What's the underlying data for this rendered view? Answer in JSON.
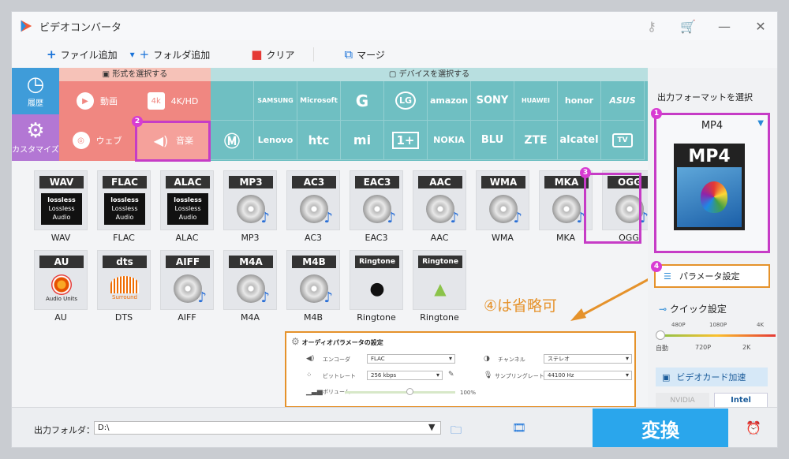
{
  "app": {
    "title": "ビデオコンバータ"
  },
  "toolbar": {
    "add_file": "ファイル追加",
    "add_folder": "フォルダ追加",
    "clear": "クリア",
    "merge": "マージ"
  },
  "sidebar": {
    "history": "履歴",
    "customize": "カスタマイズ"
  },
  "format_section": {
    "header": "形式を選択する",
    "items": [
      "動画",
      "4K/HD",
      "ウェブ",
      "音楽"
    ]
  },
  "device_section": {
    "header": "デバイスを選択する",
    "row1": [
      "",
      "SAMSUNG",
      "Microsoft",
      "G",
      "LG",
      "amazon",
      "SONY",
      "HUAWEI",
      "honor",
      "ASUS"
    ],
    "row2": [
      "",
      "Lenovo",
      "htc",
      "mi",
      "1+",
      "NOKIA",
      "BLU",
      "ZTE",
      "alcatel",
      "TV"
    ]
  },
  "formats": [
    {
      "name": "WAV",
      "top": "WAV",
      "type": "lossless"
    },
    {
      "name": "FLAC",
      "top": "FLAC",
      "type": "lossless"
    },
    {
      "name": "ALAC",
      "top": "ALAC",
      "type": "lossless"
    },
    {
      "name": "MP3",
      "top": "MP3",
      "type": "disc"
    },
    {
      "name": "AC3",
      "top": "AC3",
      "type": "disc"
    },
    {
      "name": "EAC3",
      "top": "EAC3",
      "type": "disc"
    },
    {
      "name": "AAC",
      "top": "AAC",
      "type": "disc"
    },
    {
      "name": "WMA",
      "top": "WMA",
      "type": "disc"
    },
    {
      "name": "MKA",
      "top": "MKA",
      "type": "disc"
    },
    {
      "name": "OGG",
      "top": "OGG",
      "type": "disc"
    },
    {
      "name": "AU",
      "top": "AU",
      "type": "au"
    },
    {
      "name": "DTS",
      "top": "dts",
      "type": "dts"
    },
    {
      "name": "AIFF",
      "top": "AIFF",
      "type": "disc"
    },
    {
      "name": "M4A",
      "top": "M4A",
      "type": "disc"
    },
    {
      "name": "M4B",
      "top": "M4B",
      "type": "disc"
    },
    {
      "name": "Ringtone",
      "top": "Ringtone",
      "type": "apple"
    },
    {
      "name": "Ringtone",
      "top": "Ringtone",
      "type": "android"
    }
  ],
  "lossless_text": {
    "brand": "lossless",
    "line1": "Lossless",
    "line2": "Audio"
  },
  "au_sub": "Audio Units",
  "dts_sub": "Surround",
  "annotation": "④は省略可",
  "audio_panel": {
    "title": "オーディオパラメータの設定",
    "encoder_label": "エンコーダ",
    "encoder": "FLAC",
    "bitrate_label": "ビットレート",
    "bitrate": "256 kbps",
    "volume_label": "ボリューム",
    "volume": "100%",
    "volume_level": 0.5,
    "channel_label": "チャンネル",
    "channel": "ステレオ",
    "samplerate_label": "サンプリングレート",
    "samplerate": "44100 Hz"
  },
  "right": {
    "output_label": "出力フォーマットを選択",
    "format": "MP4",
    "icon_text": "MP4",
    "param_btn": "パラメータ設定",
    "quick_label": "クイック設定",
    "quick_top": [
      "480P",
      "1080P",
      "4K"
    ],
    "quick_bottom": [
      "自動",
      "720P",
      "2K"
    ],
    "gpu_btn": "ビデオカード加速",
    "nvidia": "NVIDIA",
    "intel": "Intel"
  },
  "badges": [
    "1",
    "2",
    "3",
    "4"
  ],
  "bottom": {
    "output_folder_label": "出力フォルダ：",
    "path": "D:\\",
    "convert": "変換"
  },
  "colors": {
    "format_bg": "#f08781",
    "device_bg": "#6fbfc2",
    "convert_bg": "#2aa6ec",
    "highlight_purple": "#c63cc6",
    "highlight_orange": "#e5922b"
  }
}
